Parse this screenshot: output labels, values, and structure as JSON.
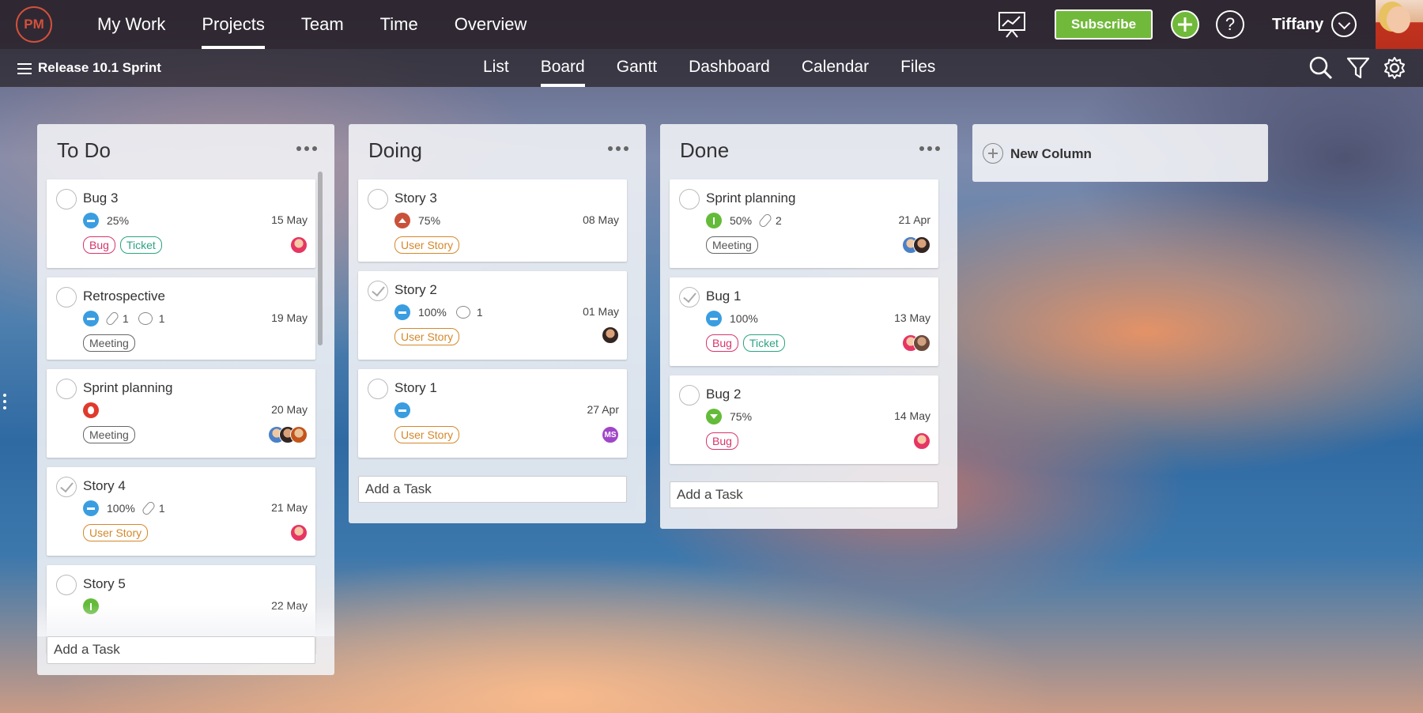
{
  "app": {
    "logo": "PM"
  },
  "topnav": {
    "items": [
      "My Work",
      "Projects",
      "Team",
      "Time",
      "Overview"
    ],
    "active": "Projects"
  },
  "header": {
    "subscribe": "Subscribe",
    "user": "Tiffany"
  },
  "project": {
    "title": "Release 10.1 Sprint"
  },
  "views": {
    "tabs": [
      "List",
      "Board",
      "Gantt",
      "Dashboard",
      "Calendar",
      "Files"
    ],
    "active": "Board"
  },
  "colors": {
    "accent": "#71b93a",
    "brand": "#d2513b",
    "tag_bug": "#d7356c",
    "tag_ticket": "#2da383",
    "tag_story": "#d4882b",
    "status_normal": "#3a9de0"
  },
  "columns": [
    {
      "title": "To Do",
      "add_task": "Add a Task",
      "cards": [
        {
          "title": "Bug 3",
          "status": "normal",
          "progress": "25%",
          "due": "15 May",
          "tags": [
            "Bug",
            "Ticket"
          ]
        },
        {
          "title": "Retrospective",
          "status": "normal",
          "attachments": "1",
          "comments": "1",
          "due": "19 May",
          "tags": [
            "Meeting"
          ]
        },
        {
          "title": "Sprint planning",
          "status": "critical",
          "due": "20 May",
          "tags": [
            "Meeting"
          ]
        },
        {
          "title": "Story 4",
          "status": "normal",
          "progress": "100%",
          "attachments": "1",
          "due": "21 May",
          "tags": [
            "User Story"
          ]
        },
        {
          "title": "Story 5",
          "status": "lowest",
          "due": "22 May",
          "tags": []
        }
      ]
    },
    {
      "title": "Doing",
      "add_task": "Add a Task",
      "cards": [
        {
          "title": "Story 3",
          "status": "high",
          "progress": "75%",
          "due": "08 May",
          "tags": [
            "User Story"
          ]
        },
        {
          "title": "Story 2",
          "status": "normal",
          "progress": "100%",
          "comments": "1",
          "due": "01 May",
          "tags": [
            "User Story"
          ]
        },
        {
          "title": "Story 1",
          "status": "normal",
          "due": "27 Apr",
          "tags": [
            "User Story"
          ],
          "avatar_initials": "MS"
        }
      ]
    },
    {
      "title": "Done",
      "add_task": "Add a Task",
      "cards": [
        {
          "title": "Sprint planning",
          "status": "lowest",
          "progress": "50%",
          "attachments": "2",
          "due": "21 Apr",
          "tags": [
            "Meeting"
          ]
        },
        {
          "title": "Bug 1",
          "status": "normal",
          "progress": "100%",
          "due": "13 May",
          "tags": [
            "Bug",
            "Ticket"
          ]
        },
        {
          "title": "Bug 2",
          "status": "low",
          "progress": "75%",
          "due": "14 May",
          "tags": [
            "Bug"
          ]
        }
      ]
    }
  ],
  "new_column": {
    "label": "New Column"
  }
}
